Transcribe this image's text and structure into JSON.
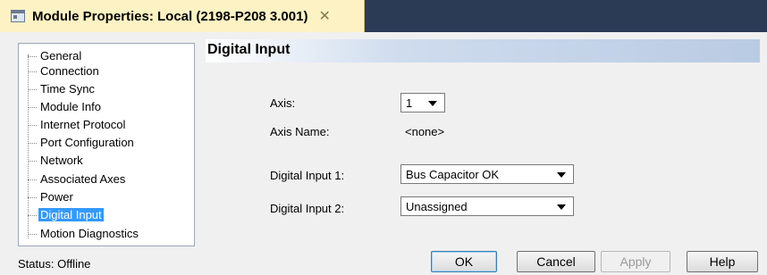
{
  "window": {
    "title": "Module Properties: Local (2198-P208 3.001)",
    "close_glyph": "✕",
    "icon": "window-icon"
  },
  "nav": {
    "items": [
      {
        "label": "General",
        "selected": false
      },
      {
        "label": "Connection",
        "selected": false
      },
      {
        "label": "Time Sync",
        "selected": false
      },
      {
        "label": "Module Info",
        "selected": false
      },
      {
        "label": "Internet Protocol",
        "selected": false
      },
      {
        "label": "Port Configuration",
        "selected": false
      },
      {
        "label": "Network",
        "selected": false
      },
      {
        "label": "Associated Axes",
        "selected": false
      },
      {
        "label": "Power",
        "selected": false
      },
      {
        "label": "Digital Input",
        "selected": true
      },
      {
        "label": "Motion Diagnostics",
        "selected": false
      }
    ]
  },
  "content": {
    "title": "Digital Input",
    "axis_label": "Axis:",
    "axis_value": "1",
    "axis_name_label": "Axis Name:",
    "axis_name_value": "<none>",
    "di1_label": "Digital Input 1:",
    "di1_value": "Bus Capacitor OK",
    "di2_label": "Digital Input 2:",
    "di2_value": "Unassigned"
  },
  "status": {
    "text": "Status:  Offline"
  },
  "buttons": {
    "ok": "OK",
    "cancel": "Cancel",
    "apply": "Apply",
    "help": "Help"
  },
  "colors": {
    "selected_bg": "#3399ff",
    "titlebar_bg": "#2b3a55",
    "tab_bg": "#fdf2c3"
  }
}
